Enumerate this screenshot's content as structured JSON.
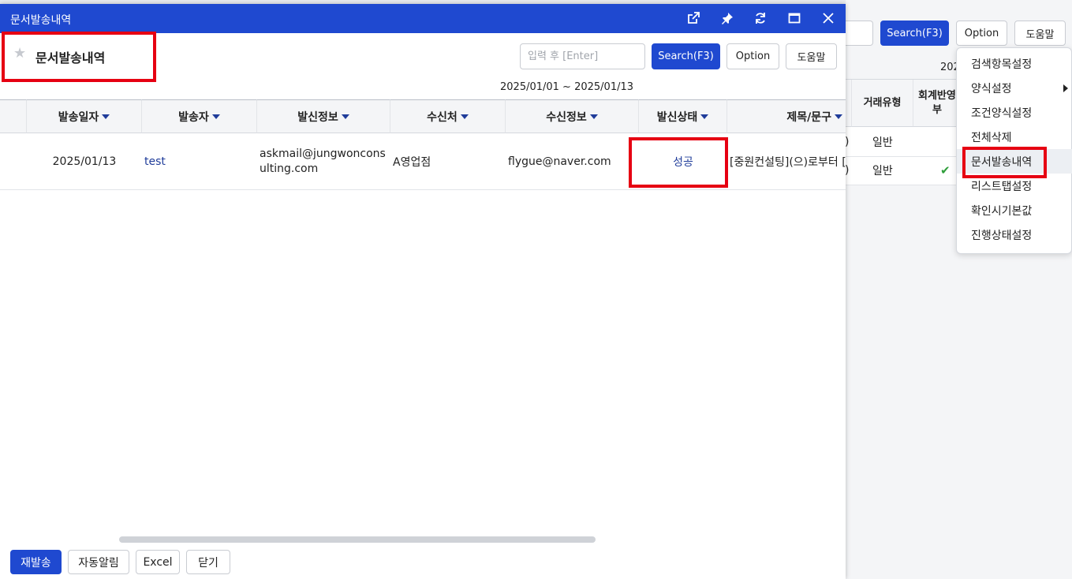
{
  "background": {
    "search_button": "Search(F3)",
    "option_button": "Option",
    "help_button": "도움말",
    "partial_date": "202",
    "table": {
      "headers": [
        "거래유형",
        "회계반영\n부"
      ],
      "rows": [
        {
          "lead": ")",
          "type": "일반",
          "check": ""
        },
        {
          "lead": ")",
          "type": "일반",
          "check": "✔"
        }
      ]
    },
    "options_menu": [
      {
        "label": "검색항목설정",
        "submenu": false
      },
      {
        "label": "양식설정",
        "submenu": true
      },
      {
        "label": "조건양식설정",
        "submenu": false
      },
      {
        "label": "전체삭제",
        "submenu": false
      },
      {
        "label": "문서발송내역",
        "submenu": false,
        "active": true
      },
      {
        "label": "리스트탭설정",
        "submenu": false
      },
      {
        "label": "확인시기본값",
        "submenu": false
      },
      {
        "label": "진행상태설정",
        "submenu": false
      }
    ]
  },
  "dialog": {
    "title": "문서발송내역",
    "page_title": "문서발송내역",
    "search_placeholder": "입력 후 [Enter]",
    "search_button": "Search(F3)",
    "option_button": "Option",
    "help_button": "도움말",
    "date_range": "2025/01/01 ~ 2025/01/13",
    "columns": [
      "발송일자",
      "발송자",
      "발신정보",
      "수신처",
      "수신정보",
      "발신상태",
      "제목/문구"
    ],
    "rows": [
      {
        "sent_date": "2025/01/13",
        "sender": "test",
        "sender_info": "askmail@jungwonconsulting.com",
        "recipient": "A영업점",
        "recipient_info": "flygue@naver.com",
        "status": "성공",
        "subject": "[중원컨설팅](으)로부터 ["
      }
    ],
    "footer_buttons": [
      "재발송",
      "자동알림",
      "Excel",
      "닫기"
    ]
  },
  "colors": {
    "brand": "#1f49d0",
    "highlight": "#e60012",
    "link": "#1f3c9a",
    "check": "#2e9e3a"
  }
}
